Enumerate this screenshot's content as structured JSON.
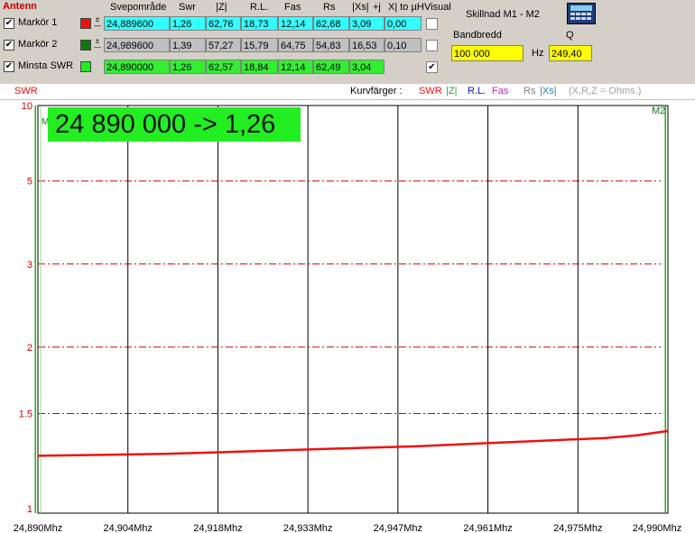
{
  "top_panel": {
    "antenna_label": "Antenn",
    "columns": [
      "Svepområde",
      "Swr",
      "|Z|",
      "R.L.",
      "Fas",
      "Rs",
      "|Xs|",
      "+j",
      "X| to µH",
      "Visual"
    ],
    "markers": [
      {
        "label": "Markör 1",
        "checked": "✔",
        "color": "#ee1111",
        "values": [
          "24,889600",
          "1,26",
          "62,76",
          "18,73",
          "12,14",
          "62,68",
          "3,09",
          "0,00"
        ],
        "visual": ""
      },
      {
        "label": "Markör 2",
        "checked": "✔",
        "color": "#117711",
        "values": [
          "24,989600",
          "1,39",
          "57,27",
          "15,79",
          "64,75",
          "54,83",
          "16,53",
          "0,10"
        ],
        "visual": ""
      },
      {
        "label": "Minsta SWR",
        "checked": "✔",
        "color": "#22ee22",
        "values": [
          "24,890000",
          "1,26",
          "62,57",
          "18,84",
          "12,14",
          "62,49",
          "3,04",
          ""
        ],
        "visual": "✔"
      }
    ],
    "diff_title": "Skillnad M1 - M2",
    "bandwidth_label": "Bandbredd",
    "bandwidth_value": "100 000",
    "bandwidth_unit": "Hz",
    "q_label": "Q",
    "q_value": "249,40"
  },
  "legend_strip": {
    "left_label": "SWR",
    "curve_colors_label": "Kurvfärger :",
    "items": [
      {
        "text": "SWR",
        "color": "#ee1111"
      },
      {
        "text": "|Z|",
        "color": "#22aa22"
      },
      {
        "text": "R.L.",
        "color": "#1111cc"
      },
      {
        "text": "Fas",
        "color": "#cc22cc"
      },
      {
        "text": "Rs",
        "color": "#808080"
      },
      {
        "text": "|Xs|",
        "color": "#2288aa"
      },
      {
        "text": "(X,R,Z = Ohms.)",
        "color": "#a0a0a0"
      }
    ]
  },
  "readout": "24 890 000 -> 1,26",
  "marker_label_m2": "M2",
  "marker_label_left": "M",
  "chart_data": {
    "type": "line",
    "x_tick_labels": [
      "24,890Mhz",
      "24,904Mhz",
      "24,918Mhz",
      "24,933Mhz",
      "24,947Mhz",
      "24,961Mhz",
      "24,975Mhz",
      "24,990Mhz"
    ],
    "xlim": [
      24.89,
      24.99
    ],
    "y_scale": "reflection-coefficient (SWR)",
    "y_ticks": [
      1,
      1.5,
      2,
      3,
      5,
      10
    ],
    "y_tick_labels": [
      "1",
      "1.5",
      "2",
      "3",
      "5",
      "10"
    ],
    "ylim": [
      1,
      10
    ],
    "grid": "dash-dot horizontal, solid vertical",
    "series": [
      {
        "color": "#ee1111",
        "x": [
          24.89,
          24.9,
          24.91,
          24.92,
          24.93,
          24.94,
          24.95,
          24.96,
          24.97,
          24.98,
          24.985,
          24.99
        ],
        "y": [
          1.26,
          1.265,
          1.27,
          1.28,
          1.29,
          1.3,
          1.31,
          1.325,
          1.34,
          1.355,
          1.37,
          1.395
        ]
      }
    ],
    "markers": [
      {
        "label": "M1",
        "x": 24.8896
      },
      {
        "label": "M2",
        "x": 24.9896
      }
    ]
  }
}
